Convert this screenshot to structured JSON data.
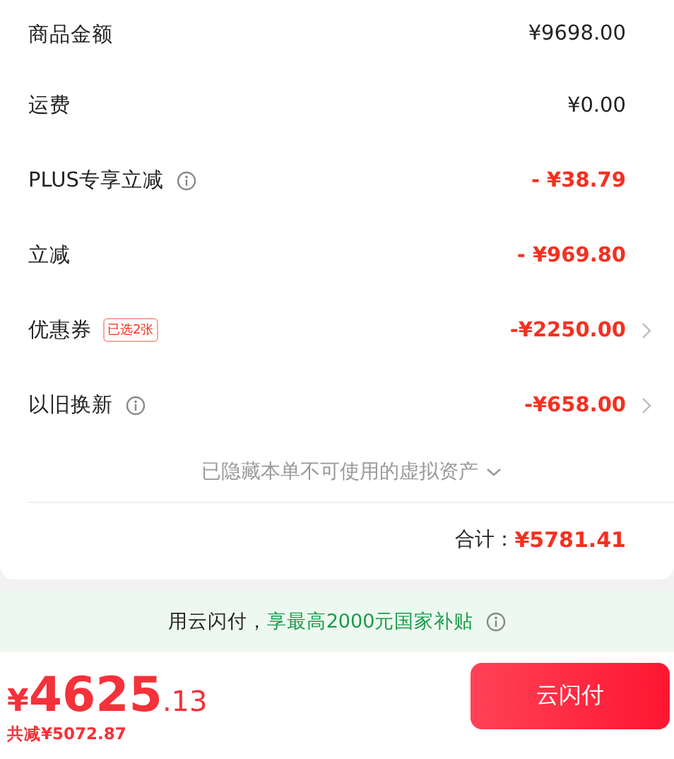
{
  "rows": [
    {
      "label": "商品金额",
      "value": "¥9698.00",
      "kind": "normal",
      "info": false,
      "arrow": false
    },
    {
      "label": "运费",
      "value": "¥0.00",
      "kind": "normal",
      "info": false,
      "arrow": false
    },
    {
      "label": "PLUS专享立减",
      "value": "- ¥38.79",
      "kind": "discount",
      "info": true,
      "arrow": false
    },
    {
      "label": "立减",
      "value": "- ¥969.80",
      "kind": "discount",
      "info": false,
      "arrow": false
    },
    {
      "label": "优惠券",
      "badge": "已选2张",
      "value": "-¥2250.00",
      "kind": "discount",
      "info": false,
      "arrow": true
    },
    {
      "label": "以旧换新",
      "value": "-¥658.00",
      "kind": "discount",
      "info": true,
      "arrow": true
    }
  ],
  "hidden_note": "已隐藏本单不可使用的虚拟资产",
  "total": {
    "label": "合计：",
    "value": "¥5781.41"
  },
  "banner": {
    "text": "用云闪付，",
    "highlight": "享最高2000元国家补贴"
  },
  "footer": {
    "currency": "¥",
    "integer": "4625",
    "decimal": ".13",
    "saving": "共减¥5072.87",
    "button": "云闪付"
  }
}
